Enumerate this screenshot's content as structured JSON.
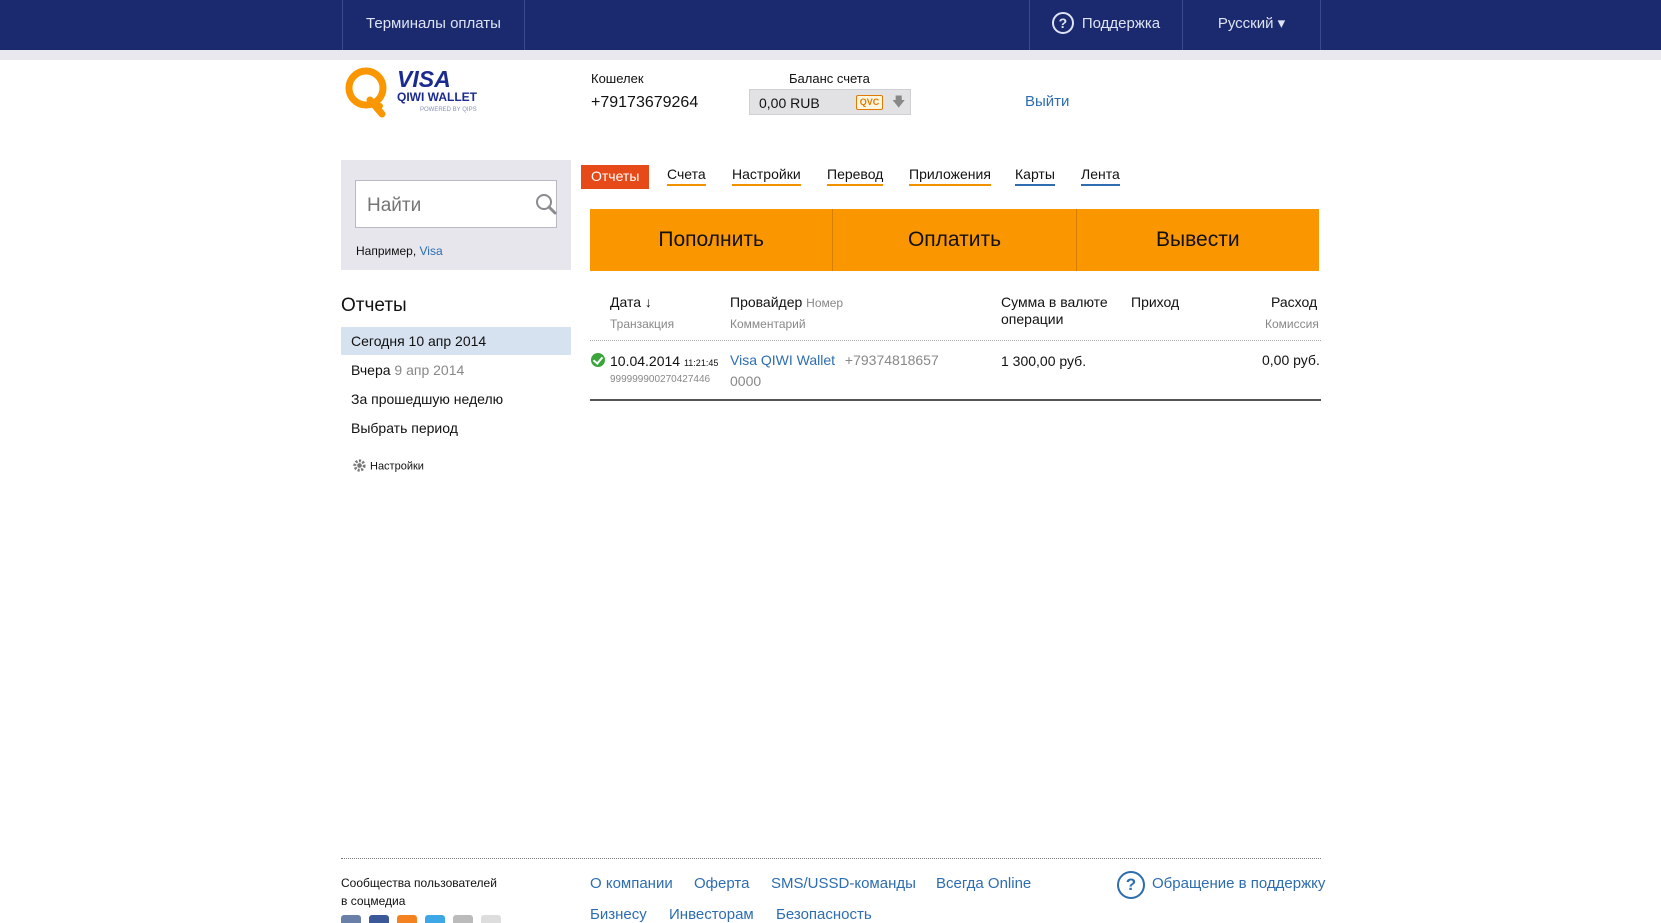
{
  "topbar": {
    "terminals": "Терминалы оплаты",
    "support": "Поддержка",
    "language": "Русский ▾"
  },
  "header": {
    "logo_visa": "VISA",
    "logo_qiwi": "QIWI WALLET",
    "logo_powered": "POWERED BY QIPS",
    "wallet_label": "Кошелек",
    "wallet_number": "+79173679264",
    "balance_label": "Баланс счета",
    "balance_value": "0,00 RUB",
    "currency_badge": "QVC",
    "logout": "Выйти"
  },
  "search": {
    "placeholder": "Найти",
    "hint_prefix": "Например,",
    "hint_example": "Visa"
  },
  "sidebar": {
    "title": "Отчеты",
    "items": [
      {
        "label": "Сегодня 10 апр 2014",
        "muted": ""
      },
      {
        "label": "Вчера",
        "muted": "9 апр 2014"
      },
      {
        "label": "За прошедшую неделю",
        "muted": ""
      },
      {
        "label": "Выбрать период",
        "muted": ""
      }
    ],
    "settings": "Настройки"
  },
  "tabs": [
    "Отчеты",
    "Счета",
    "Настройки",
    "Перевод",
    "Приложения",
    "Карты",
    "Лента"
  ],
  "actions": [
    "Пополнить",
    "Оплатить",
    "Вывести"
  ],
  "table": {
    "headers": {
      "date": "Дата ↓",
      "transaction": "Транзакция",
      "provider": "Провайдер",
      "number": "Номер",
      "comment": "Комментарий",
      "amount_line1": "Сумма в валюте",
      "amount_line2": "операции",
      "income": "Приход",
      "expense": "Расход",
      "commission": "Комиссия"
    },
    "rows": [
      {
        "status": "success",
        "date": "10.04.2014",
        "time": "11:21:45",
        "transaction": "999999900270427446",
        "provider": "Visa QIWI Wallet",
        "number": "+79374818657",
        "comment": "0000",
        "amount": "1 300,00 руб.",
        "income": "",
        "expense": "0,00 руб."
      }
    ]
  },
  "footer": {
    "social_line1": "Сообщества пользователей",
    "social_line2": "в соцмедиа",
    "links_row1": [
      "О компании",
      "Оферта",
      "SMS/USSD-команды",
      "Всегда Online"
    ],
    "links_row2": [
      "Бизнесу",
      "Инвесторам",
      "Безопасность"
    ],
    "support_link": "Обращение в поддержку"
  },
  "colors": {
    "topbar": "#1b2a6f",
    "accent_orange": "#f99600",
    "active_tab": "#e64a19",
    "link": "#2d6db0"
  }
}
